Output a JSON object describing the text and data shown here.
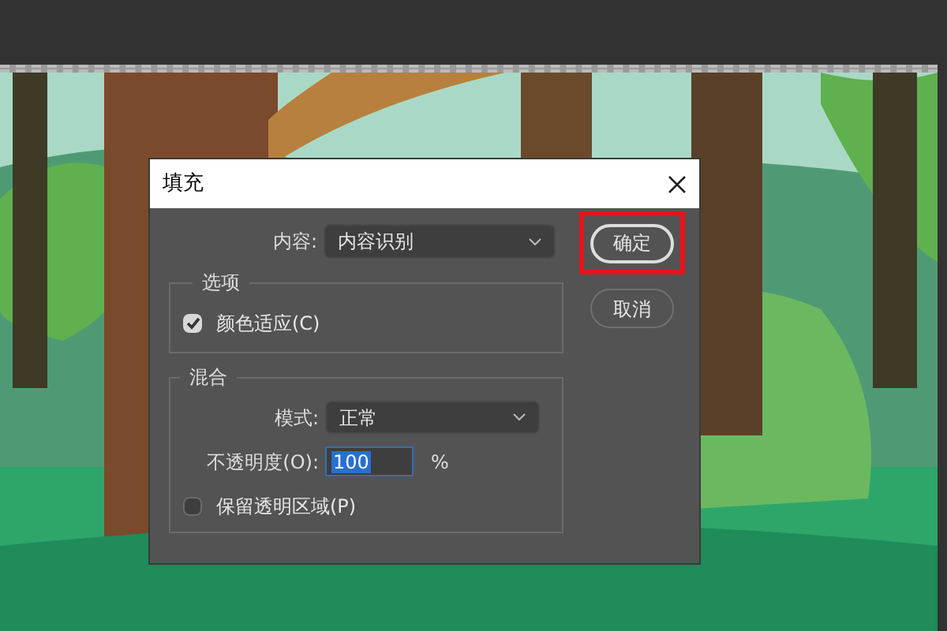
{
  "dialog": {
    "title": "填充",
    "content": {
      "label": "内容:",
      "value": "内容识别"
    },
    "options_group": {
      "title": "选项",
      "checkbox": {
        "label": "颜色适应(C)",
        "checked": true
      }
    },
    "blend_group": {
      "title": "混合",
      "mode": {
        "label": "模式:",
        "value": "正常"
      },
      "opacity": {
        "label": "不透明度(O):",
        "value": "100",
        "unit": "%",
        "selected": true
      },
      "checkbox": {
        "label": "保留透明区域(P)",
        "checked": false
      }
    },
    "buttons": [
      {
        "label": "确定",
        "highlighted": true
      },
      {
        "label": "取消",
        "highlighted": false
      }
    ]
  }
}
